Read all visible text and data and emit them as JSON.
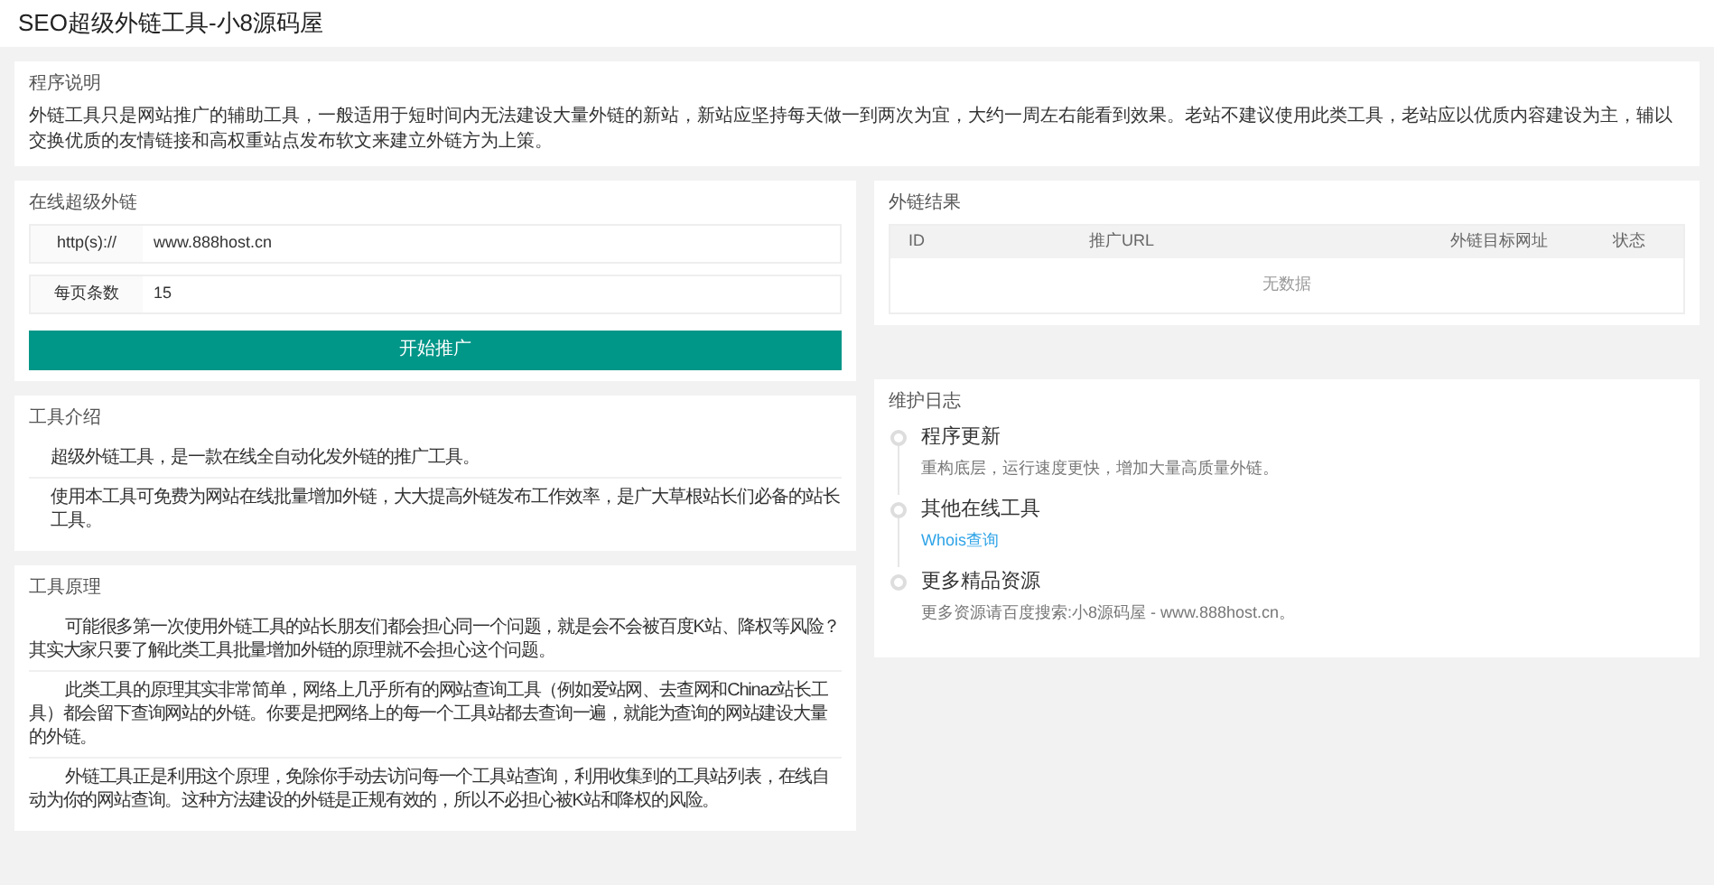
{
  "header": {
    "title": "SEO超级外链工具-小8源码屋"
  },
  "intro_card": {
    "title": "程序说明",
    "text": "外链工具只是网站推广的辅助工具，一般适用于短时间内无法建设大量外链的新站，新站应坚持每天做一到两次为宜，大约一周左右能看到效果。老站不建议使用此类工具，老站应以优质内容建设为主，辅以交换优质的友情链接和高权重站点发布软文来建立外链方为上策。"
  },
  "form_card": {
    "title": "在线超级外链",
    "fields": [
      {
        "label": "http(s)://",
        "value": "www.888host.cn"
      },
      {
        "label": "每页条数",
        "value": "15"
      }
    ],
    "button": "开始推广"
  },
  "results_card": {
    "title": "外链结果",
    "columns": [
      "ID",
      "推广URL",
      "外链目标网址",
      "状态"
    ],
    "empty_text": "无数据"
  },
  "about_card": {
    "title": "工具介绍",
    "paragraphs": [
      "超级外链工具，是一款在线全自动化发外链的推广工具。",
      "使用本工具可免费为网站在线批量增加外链，大大提高外链发布工作效率，是广大草根站长们必备的站长工具。"
    ]
  },
  "log_card": {
    "title": "维护日志",
    "entries": [
      {
        "title": "程序更新",
        "text": "重构底层，运行速度更快，增加大量高质量外链。",
        "kind": "text"
      },
      {
        "title": "其他在线工具",
        "text": "Whois查询",
        "kind": "link"
      },
      {
        "title": "更多精品资源",
        "text": "更多资源请百度搜索:小8源码屋 - www.888host.cn。",
        "kind": "text"
      }
    ]
  },
  "principle_card": {
    "title": "工具原理",
    "paragraphs": [
      "可能很多第一次使用外链工具的站长朋友们都会担心同一个问题，就是会不会被百度K站、降权等风险？其实大家只要了解此类工具批量增加外链的原理就不会担心这个问题。",
      "此类工具的原理其实非常简单，网络上几乎所有的网站查询工具（例如爱站网、去查网和Chinaz站长工具）都会留下查询网站的外链。你要是把网络上的每一个工具站都去查询一遍，就能为查询的网站建设大量的外链。",
      "外链工具正是利用这个原理，免除你手动去访问每一个工具站查询，利用收集到的工具站列表，在线自动为你的网站查询。这种方法建设的外链是正规有效的，所以不必担心被K站和降权的风险。"
    ]
  }
}
